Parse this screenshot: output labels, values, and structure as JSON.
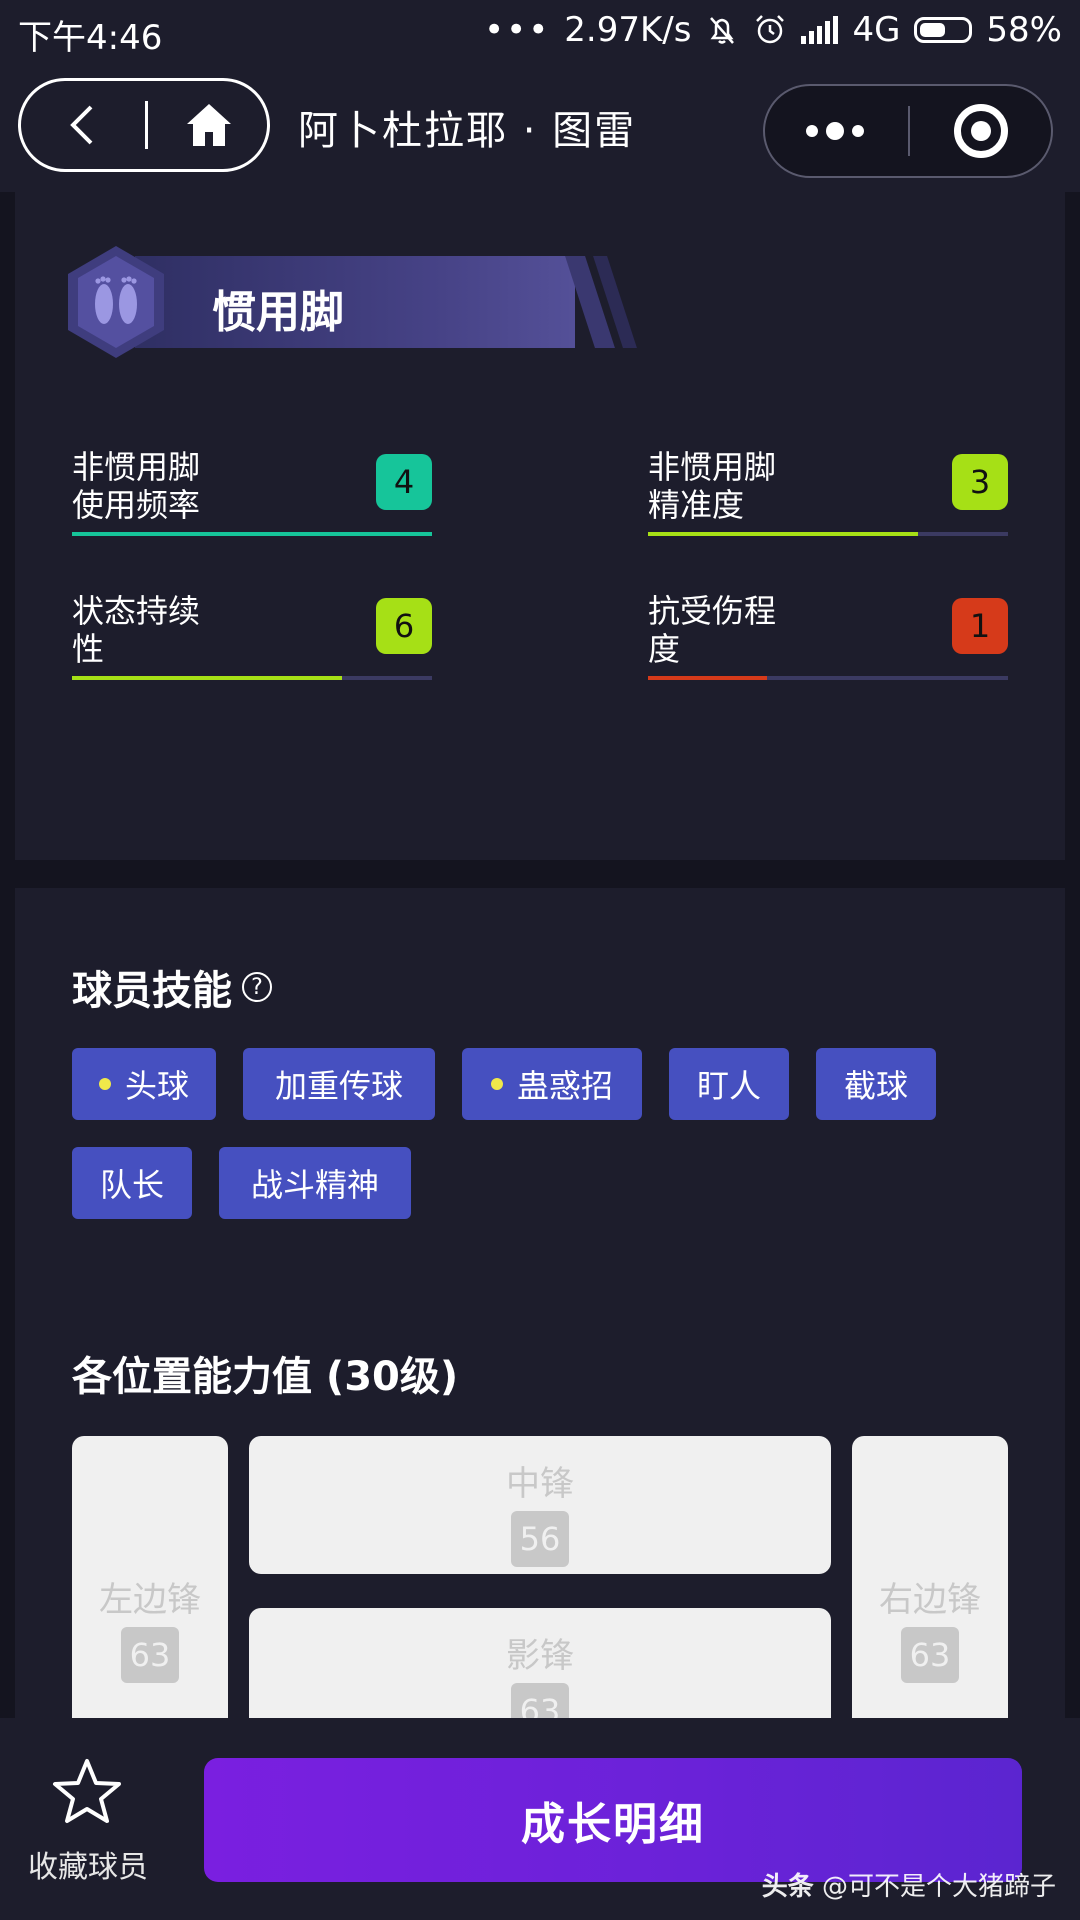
{
  "status_bar": {
    "time": "下午4:46",
    "dots": "•••",
    "network_speed": "2.97K/s",
    "network_type": "4G",
    "battery": "58%",
    "battery_level": 0.58
  },
  "nav": {
    "title": "阿卜杜拉耶 · 图雷"
  },
  "foot_section": {
    "title": "惯用脚",
    "stats": [
      {
        "label": "非惯用脚\n使用频率",
        "value": "4",
        "color": "#16c59a",
        "fill": 1.0
      },
      {
        "label": "非惯用脚\n精准度",
        "value": "3",
        "color": "#a6e016",
        "fill": 0.75
      },
      {
        "label": "状态持续\n性",
        "value": "6",
        "color": "#a6e016",
        "fill": 0.75
      },
      {
        "label": "抗受伤程\n度",
        "value": "1",
        "color": "#d63a1a",
        "fill": 0.33
      }
    ]
  },
  "skills": {
    "title": "球员技能",
    "help": "?",
    "items": [
      {
        "label": "头球",
        "dot": true
      },
      {
        "label": "加重传球",
        "dot": false
      },
      {
        "label": "蛊惑招",
        "dot": true
      },
      {
        "label": "盯人",
        "dot": false
      },
      {
        "label": "截球",
        "dot": false
      },
      {
        "label": "队长",
        "dot": false
      },
      {
        "label": "战斗精神",
        "dot": false
      }
    ]
  },
  "positions": {
    "title": "各位置能力值 (30级)",
    "items": [
      {
        "name": "左边锋",
        "value": "63"
      },
      {
        "name": "中锋",
        "value": "56"
      },
      {
        "name": "影锋",
        "value": "63"
      },
      {
        "name": "右边锋",
        "value": "63"
      }
    ]
  },
  "bottom": {
    "favorite_label": "收藏球员",
    "growth_button": "成长明细",
    "watermark_prefix": "头条",
    "watermark_text": "@可不是个大猪蹄子"
  }
}
